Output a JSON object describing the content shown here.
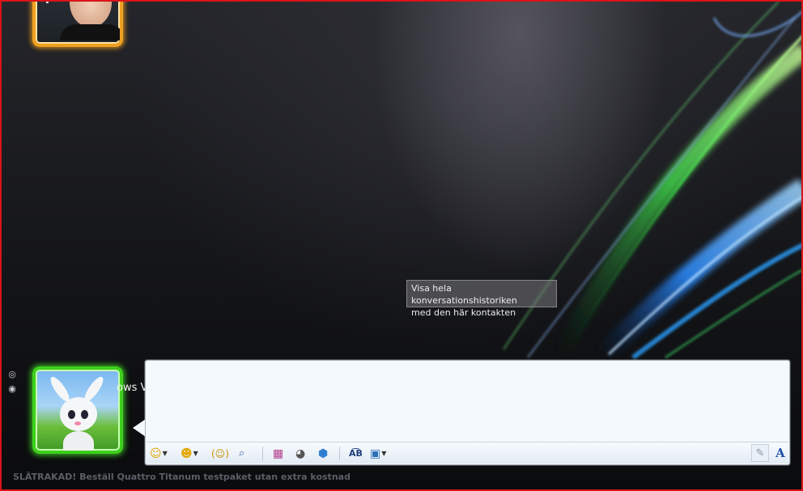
{
  "window": {
    "border_color": "#d8141a",
    "background_theme": "Windows Vista aurora"
  },
  "contact": {
    "avatar_frame_color": "#f0a020",
    "status": "busy"
  },
  "user": {
    "avatar_frame_color": "#3ed01c",
    "status": "online",
    "name_fragment": "ows V"
  },
  "side_icons": [
    "camera-icon",
    "webcam-icon"
  ],
  "tooltip": {
    "line1": "Visa hela konversationshistoriken",
    "line2": "med den här kontakten"
  },
  "compose": {
    "text": "",
    "background": "#f4f9fd"
  },
  "toolbar": {
    "buttons": [
      {
        "name": "emoticon-icon",
        "glyph": "☺",
        "dropdown": true
      },
      {
        "name": "wink-icon",
        "glyph": "☻",
        "dropdown": true
      },
      {
        "name": "nudge-icon",
        "glyph": "(☺)",
        "dropdown": false
      },
      {
        "name": "voice-clip-icon",
        "glyph": "💬",
        "dropdown": false
      },
      {
        "name": "background-icon",
        "glyph": "▦",
        "dropdown": false
      },
      {
        "name": "sound-icon",
        "glyph": "◕",
        "dropdown": false
      },
      {
        "name": "games-icon",
        "glyph": "⬢",
        "dropdown": false
      },
      {
        "name": "spellcheck-icon",
        "glyph": "A͡B",
        "dropdown": false
      },
      {
        "name": "send-file-icon",
        "glyph": "▣",
        "dropdown": true
      }
    ],
    "handwriting_icon": "✎",
    "font_icon": "A"
  },
  "ad_text": "SLÄTRAKAD! Beställ Quattro Titanum testpaket utan extra kostnad"
}
